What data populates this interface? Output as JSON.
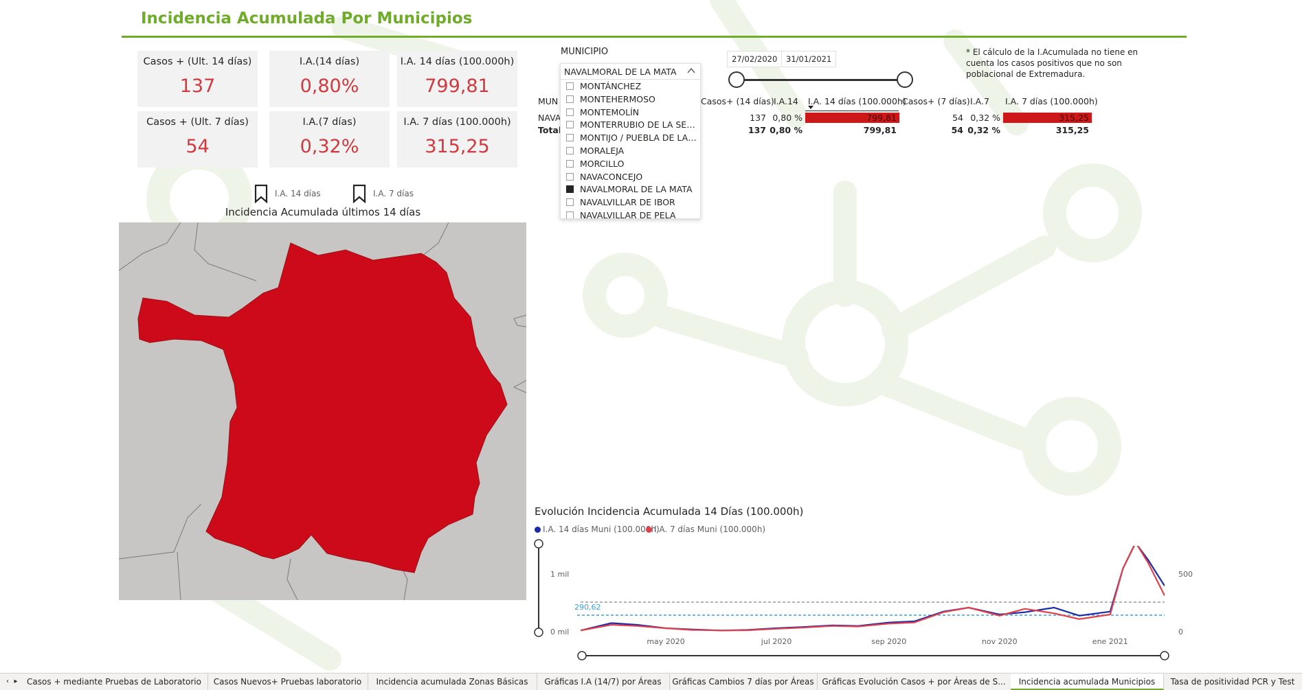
{
  "title": "Incidencia Acumulada Por Municipios",
  "colors": {
    "accent": "#6eac2a",
    "value_red": "#d0393e",
    "bar_red": "#cd1719",
    "series1": "#1a2aa8",
    "series2": "#e0414a",
    "map_fill": "#cd0a1a"
  },
  "cards": [
    {
      "label": "Casos + (Ult. 14 días)",
      "value": "137"
    },
    {
      "label": "I.A.(14 días)",
      "value": "0,80%"
    },
    {
      "label": "I.A. 14 días (100.000h)",
      "value": "799,81"
    },
    {
      "label": "Casos + (Ult. 7 días)",
      "value": "54"
    },
    {
      "label": "I.A.(7 días)",
      "value": "0,32%"
    },
    {
      "label": "I.A. 7 días (100.000h)",
      "value": "315,25"
    }
  ],
  "bookmarks": [
    {
      "label": "I.A. 14 días",
      "icon": "bookmark-icon"
    },
    {
      "label": "I.A. 7 días",
      "icon": "bookmark-icon"
    }
  ],
  "map": {
    "title": "Incidencia Acumulada últimos 14 días"
  },
  "slicer": {
    "title": "MUNICIPIO",
    "selected": "NAVALMORAL DE LA MATA",
    "items": [
      {
        "label": "MONTÁNCHEZ",
        "checked": false
      },
      {
        "label": "MONTEHERMOSO",
        "checked": false
      },
      {
        "label": "MONTEMOLÍN",
        "checked": false
      },
      {
        "label": "MONTERRUBIO DE LA SERE...",
        "checked": false
      },
      {
        "label": "MONTIJO / PUEBLA DE LA C...",
        "checked": false
      },
      {
        "label": "MORALEJA",
        "checked": false
      },
      {
        "label": "MORCILLO",
        "checked": false
      },
      {
        "label": "NAVACONCEJO",
        "checked": false
      },
      {
        "label": "NAVALMORAL DE LA MATA",
        "checked": true
      },
      {
        "label": "NAVALVILLAR DE IBOR",
        "checked": false
      },
      {
        "label": "NAVALVILLAR DE PELA",
        "checked": false
      }
    ]
  },
  "date_range": {
    "start": "27/02/2020",
    "end": "31/01/2021"
  },
  "note": "* El cálculo de la I.Acumulada no tiene en cuenta los casos positivos que no son poblacional de Extremadura.",
  "table": {
    "headers": [
      "MUN",
      "Casos+ (14 días)",
      "I.A.14",
      "I.A. 14 días (100.000h)",
      "Casos+ (7 días)",
      "I.A.7",
      "I.A. 7 días (100.000h)"
    ],
    "row": {
      "name": "NAVA",
      "casos14": "137",
      "ia14": "0,80 %",
      "ia14_100k": "799,81",
      "casos7": "54",
      "ia7": "0,32 %",
      "ia7_100k": "315,25"
    },
    "total": {
      "name": "Total",
      "casos14": "137",
      "ia14": "0,80 %",
      "ia14_100k": "799,81",
      "casos7": "54",
      "ia7": "0,32 %",
      "ia7_100k": "315,25"
    }
  },
  "chart_data": {
    "type": "line",
    "title": "Evolución Incidencia Acumulada 14 Días (100.000h)",
    "series": [
      {
        "name": "I.A. 14 días Muni (100.000h)",
        "axis": "left"
      },
      {
        "name": "I.A. 7 días Muni (100.000h)",
        "axis": "right"
      }
    ],
    "x_ticks": [
      "may 2020",
      "jul 2020",
      "sep 2020",
      "nov 2020",
      "ene 2021"
    ],
    "y_left_ticks": [
      "0 mil",
      "1 mil"
    ],
    "y_right_ticks": [
      "0",
      "500"
    ],
    "reference_line_label": "290,62",
    "ylim_left": [
      0,
      1500
    ],
    "ylim_right": [
      0,
      750
    ],
    "x": [
      "2020-03-15",
      "2020-04-01",
      "2020-04-15",
      "2020-05-01",
      "2020-05-15",
      "2020-06-01",
      "2020-06-15",
      "2020-07-01",
      "2020-07-15",
      "2020-08-01",
      "2020-08-15",
      "2020-09-01",
      "2020-09-15",
      "2020-10-01",
      "2020-10-15",
      "2020-11-01",
      "2020-11-15",
      "2020-12-01",
      "2020-12-15",
      "2021-01-01",
      "2021-01-08",
      "2021-01-15",
      "2021-01-22",
      "2021-01-31"
    ],
    "series_values": [
      [
        20,
        150,
        120,
        60,
        40,
        20,
        30,
        60,
        80,
        110,
        100,
        160,
        180,
        350,
        420,
        300,
        340,
        420,
        280,
        350,
        1100,
        1550,
        1250,
        800
      ],
      [
        10,
        60,
        50,
        30,
        15,
        10,
        12,
        25,
        35,
        50,
        45,
        70,
        80,
        170,
        210,
        140,
        200,
        160,
        110,
        150,
        550,
        780,
        600,
        315
      ]
    ]
  },
  "tabs": [
    "Casos + mediante Pruebas de Laboratorio",
    "Casos Nuevos+ Pruebas laboratorio",
    "Incidencia acumulada Zonas Básicas",
    "Gráficas I.A (14/7) por Áreas",
    "Gráficas Cambios 7 días por Áreas",
    "Gráficas Evolución Casos + por Áreas de S...",
    "Incidencia acumulada Municipios",
    "Tasa de positividad PCR y Test"
  ],
  "active_tab": 6
}
